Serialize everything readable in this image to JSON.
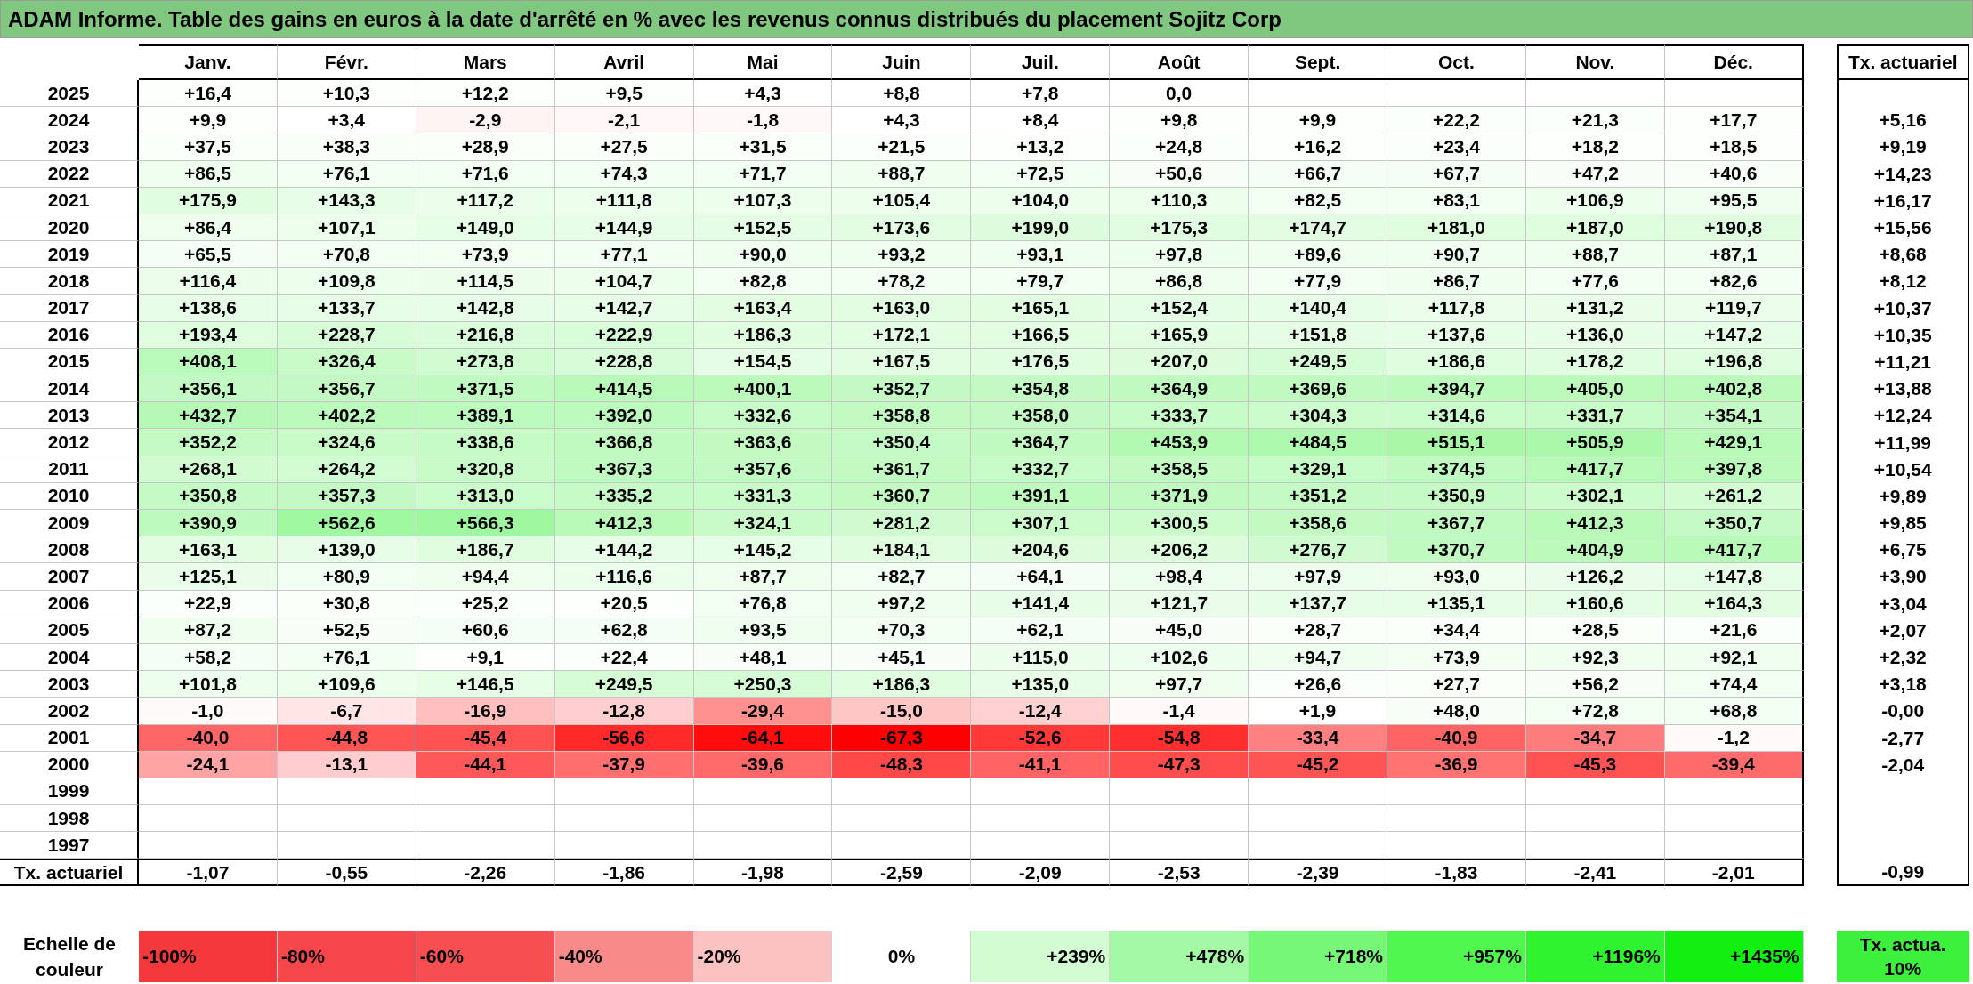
{
  "title": "ADAM Informe. Table des gains en euros à la date d'arrêté en % avec les revenus connus distribués du placement Sojitz Corp",
  "table": {
    "columns": [
      "Janv.",
      "Févr.",
      "Mars",
      "Avril",
      "Mai",
      "Juin",
      "Juil.",
      "Août",
      "Sept.",
      "Oct.",
      "Nov.",
      "Déc."
    ],
    "rate_column": "Tx. actuariel",
    "rows": [
      {
        "year": "2025",
        "values": [
          "+16,4",
          "+10,3",
          "+12,2",
          "+9,5",
          "+4,3",
          "+8,8",
          "+7,8",
          "0,0"
        ]
      },
      {
        "year": "2024",
        "values": [
          "+9,9",
          "+3,4",
          "-2,9",
          "-2,1",
          "-1,8",
          "+4,3",
          "+8,4",
          "+9,8",
          "+9,9",
          "+22,2",
          "+21,3",
          "+17,7"
        ],
        "rate": "+5,16"
      },
      {
        "year": "2023",
        "values": [
          "+37,5",
          "+38,3",
          "+28,9",
          "+27,5",
          "+31,5",
          "+21,5",
          "+13,2",
          "+24,8",
          "+16,2",
          "+23,4",
          "+18,2",
          "+18,5"
        ],
        "rate": "+9,19"
      },
      {
        "year": "2022",
        "values": [
          "+86,5",
          "+76,1",
          "+71,6",
          "+74,3",
          "+71,7",
          "+88,7",
          "+72,5",
          "+50,6",
          "+66,7",
          "+67,7",
          "+47,2",
          "+40,6"
        ],
        "rate": "+14,23"
      },
      {
        "year": "2021",
        "values": [
          "+175,9",
          "+143,3",
          "+117,2",
          "+111,8",
          "+107,3",
          "+105,4",
          "+104,0",
          "+110,3",
          "+82,5",
          "+83,1",
          "+106,9",
          "+95,5"
        ],
        "rate": "+16,17"
      },
      {
        "year": "2020",
        "values": [
          "+86,4",
          "+107,1",
          "+149,0",
          "+144,9",
          "+152,5",
          "+173,6",
          "+199,0",
          "+175,3",
          "+174,7",
          "+181,0",
          "+187,0",
          "+190,8"
        ],
        "rate": "+15,56"
      },
      {
        "year": "2019",
        "values": [
          "+65,5",
          "+70,8",
          "+73,9",
          "+77,1",
          "+90,0",
          "+93,2",
          "+93,1",
          "+97,8",
          "+89,6",
          "+90,7",
          "+88,7",
          "+87,1"
        ],
        "rate": "+8,68"
      },
      {
        "year": "2018",
        "values": [
          "+116,4",
          "+109,8",
          "+114,5",
          "+104,7",
          "+82,8",
          "+78,2",
          "+79,7",
          "+86,8",
          "+77,9",
          "+86,7",
          "+77,6",
          "+82,6"
        ],
        "rate": "+8,12"
      },
      {
        "year": "2017",
        "values": [
          "+138,6",
          "+133,7",
          "+142,8",
          "+142,7",
          "+163,4",
          "+163,0",
          "+165,1",
          "+152,4",
          "+140,4",
          "+117,8",
          "+131,2",
          "+119,7"
        ],
        "rate": "+10,37"
      },
      {
        "year": "2016",
        "values": [
          "+193,4",
          "+228,7",
          "+216,8",
          "+222,9",
          "+186,3",
          "+172,1",
          "+166,5",
          "+165,9",
          "+151,8",
          "+137,6",
          "+136,0",
          "+147,2"
        ],
        "rate": "+10,35"
      },
      {
        "year": "2015",
        "values": [
          "+408,1",
          "+326,4",
          "+273,8",
          "+228,8",
          "+154,5",
          "+167,5",
          "+176,5",
          "+207,0",
          "+249,5",
          "+186,6",
          "+178,2",
          "+196,8"
        ],
        "rate": "+11,21"
      },
      {
        "year": "2014",
        "values": [
          "+356,1",
          "+356,7",
          "+371,5",
          "+414,5",
          "+400,1",
          "+352,7",
          "+354,8",
          "+364,9",
          "+369,6",
          "+394,7",
          "+405,0",
          "+402,8"
        ],
        "rate": "+13,88"
      },
      {
        "year": "2013",
        "values": [
          "+432,7",
          "+402,2",
          "+389,1",
          "+392,0",
          "+332,6",
          "+358,8",
          "+358,0",
          "+333,7",
          "+304,3",
          "+314,6",
          "+331,7",
          "+354,1"
        ],
        "rate": "+12,24"
      },
      {
        "year": "2012",
        "values": [
          "+352,2",
          "+324,6",
          "+338,6",
          "+366,8",
          "+363,6",
          "+350,4",
          "+364,7",
          "+453,9",
          "+484,5",
          "+515,1",
          "+505,9",
          "+429,1"
        ],
        "rate": "+11,99"
      },
      {
        "year": "2011",
        "values": [
          "+268,1",
          "+264,2",
          "+320,8",
          "+367,3",
          "+357,6",
          "+361,7",
          "+332,7",
          "+358,5",
          "+329,1",
          "+374,5",
          "+417,7",
          "+397,8"
        ],
        "rate": "+10,54"
      },
      {
        "year": "2010",
        "values": [
          "+350,8",
          "+357,3",
          "+313,0",
          "+335,2",
          "+331,3",
          "+360,7",
          "+391,1",
          "+371,9",
          "+351,2",
          "+350,9",
          "+302,1",
          "+261,2"
        ],
        "rate": "+9,89"
      },
      {
        "year": "2009",
        "values": [
          "+390,9",
          "+562,6",
          "+566,3",
          "+412,3",
          "+324,1",
          "+281,2",
          "+307,1",
          "+300,5",
          "+358,6",
          "+367,7",
          "+412,3",
          "+350,7"
        ],
        "rate": "+9,85"
      },
      {
        "year": "2008",
        "values": [
          "+163,1",
          "+139,0",
          "+186,7",
          "+144,2",
          "+145,2",
          "+184,1",
          "+204,6",
          "+206,2",
          "+276,7",
          "+370,7",
          "+404,9",
          "+417,7"
        ],
        "rate": "+6,75"
      },
      {
        "year": "2007",
        "values": [
          "+125,1",
          "+80,9",
          "+94,4",
          "+116,6",
          "+87,7",
          "+82,7",
          "+64,1",
          "+98,4",
          "+97,9",
          "+93,0",
          "+126,2",
          "+147,8"
        ],
        "rate": "+3,90"
      },
      {
        "year": "2006",
        "values": [
          "+22,9",
          "+30,8",
          "+25,2",
          "+20,5",
          "+76,8",
          "+97,2",
          "+141,4",
          "+121,7",
          "+137,7",
          "+135,1",
          "+160,6",
          "+164,3"
        ],
        "rate": "+3,04"
      },
      {
        "year": "2005",
        "values": [
          "+87,2",
          "+52,5",
          "+60,6",
          "+62,8",
          "+93,5",
          "+70,3",
          "+62,1",
          "+45,0",
          "+28,7",
          "+34,4",
          "+28,5",
          "+21,6"
        ],
        "rate": "+2,07"
      },
      {
        "year": "2004",
        "values": [
          "+58,2",
          "+76,1",
          "+9,1",
          "+22,4",
          "+48,1",
          "+45,1",
          "+115,0",
          "+102,6",
          "+94,7",
          "+73,9",
          "+92,3",
          "+92,1"
        ],
        "rate": "+2,32"
      },
      {
        "year": "2003",
        "values": [
          "+101,8",
          "+109,6",
          "+146,5",
          "+249,5",
          "+250,3",
          "+186,3",
          "+135,0",
          "+97,7",
          "+26,6",
          "+27,7",
          "+56,2",
          "+74,4"
        ],
        "rate": "+3,18"
      },
      {
        "year": "2002",
        "values": [
          "-1,0",
          "-6,7",
          "-16,9",
          "-12,8",
          "-29,4",
          "-15,0",
          "-12,4",
          "-1,4",
          "+1,9",
          "+48,0",
          "+72,8",
          "+68,8"
        ],
        "rate": "-0,00"
      },
      {
        "year": "2001",
        "values": [
          "-40,0",
          "-44,8",
          "-45,4",
          "-56,6",
          "-64,1",
          "-67,3",
          "-52,6",
          "-54,8",
          "-33,4",
          "-40,9",
          "-34,7",
          "-1,2"
        ],
        "rate": "-2,77"
      },
      {
        "year": "2000",
        "values": [
          "-24,1",
          "-13,1",
          "-44,1",
          "-37,9",
          "-39,6",
          "-48,3",
          "-41,1",
          "-47,3",
          "-45,2",
          "-36,9",
          "-45,3",
          "-39,4"
        ],
        "rate": "-2,04"
      },
      {
        "year": "1999"
      },
      {
        "year": "1998"
      },
      {
        "year": "1997"
      }
    ],
    "footer": {
      "label": "Tx. actuariel",
      "values": [
        "-1,07",
        "-0,55",
        "-2,26",
        "-1,86",
        "-1,98",
        "-2,59",
        "-2,09",
        "-2,53",
        "-2,39",
        "-1,83",
        "-2,41",
        "-2,01"
      ],
      "rate": "-0,99"
    }
  },
  "legend": {
    "label": "Echelle de couleur",
    "items": [
      {
        "label": "-100%",
        "color": "#f5383c"
      },
      {
        "label": "-80%",
        "color": "#f6464a"
      },
      {
        "label": "-60%",
        "color": "#f74e52"
      },
      {
        "label": "-40%",
        "color": "#f98a8a"
      },
      {
        "label": "-20%",
        "color": "#fcc2c2"
      },
      {
        "label": "0%",
        "color": "#ffffff"
      },
      {
        "label": "+239%",
        "color": "#d2fcd2"
      },
      {
        "label": "+478%",
        "color": "#a4f9a4"
      },
      {
        "label": "+718%",
        "color": "#76f776"
      },
      {
        "label": "+957%",
        "color": "#4ef64e"
      },
      {
        "label": "+1196%",
        "color": "#2ef32e"
      },
      {
        "label": "+1435%",
        "color": "#12f012"
      }
    ],
    "rate": {
      "label": "Tx. actua. 10%",
      "color": "#3ef03e"
    }
  }
}
